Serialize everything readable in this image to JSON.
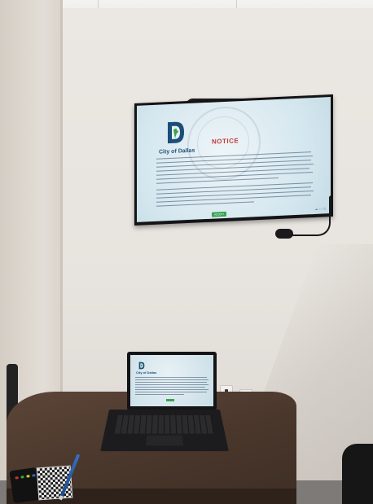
{
  "photo": {
    "subject": "meeting-room-display",
    "tv_screen": {
      "logo_text": "City of Dallas",
      "heading": "NOTICE",
      "button_label": "ACCEPT"
    },
    "laptop_screen": {
      "logo_text": "City of Dallas"
    }
  },
  "colors": {
    "notice_red": "#c23a3a",
    "logo_blue": "#1c4e7a",
    "logo_green": "#3ea34a",
    "accept_green": "#39a356",
    "wall": "#e7e3de",
    "table_wood": "#4a372c"
  },
  "icons": [
    "city-of-dallas-logo-icon",
    "seal-watermark-icon"
  ]
}
